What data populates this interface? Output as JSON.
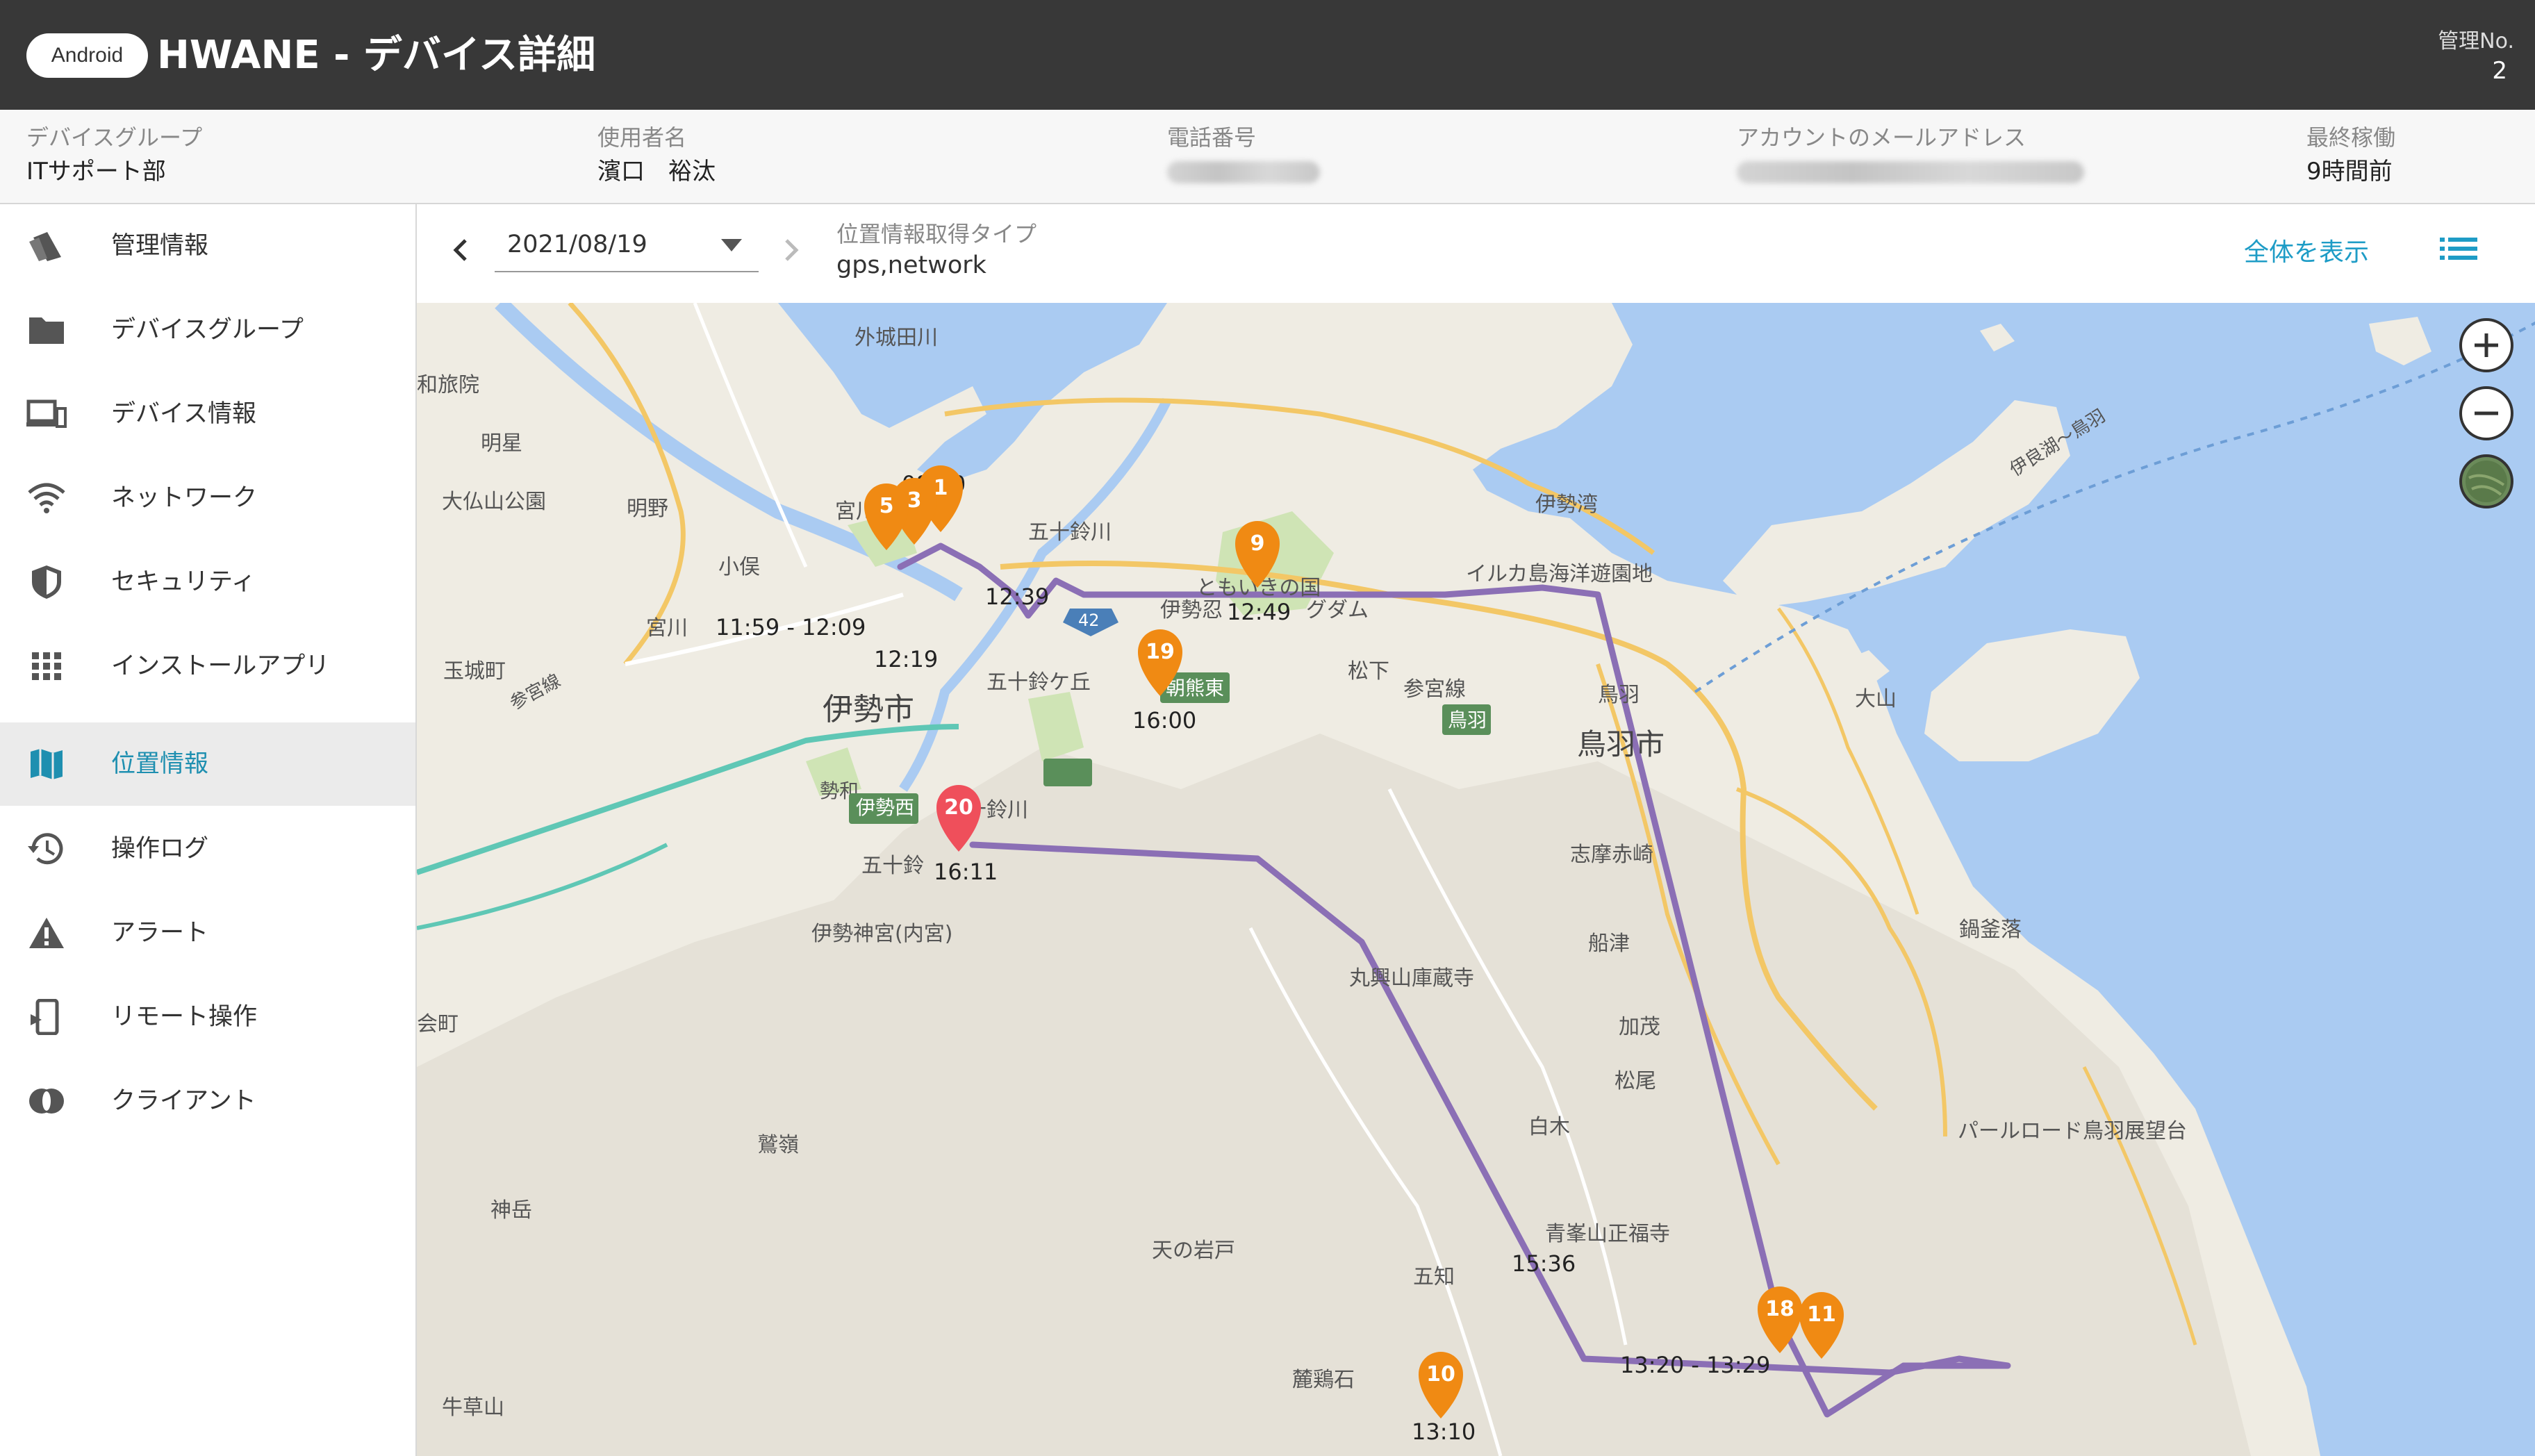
{
  "header": {
    "os_badge": "Android",
    "title": "HWANE - デバイス詳細",
    "mgmt_no_label": "管理No.",
    "mgmt_no_value": "2"
  },
  "info": {
    "device_group_label": "デバイスグループ",
    "device_group_value": "ITサポート部",
    "user_label": "使用者名",
    "user_value": "濱口　裕汰",
    "phone_label": "電話番号",
    "email_label": "アカウントのメールアドレス",
    "last_active_label": "最終稼働",
    "last_active_value": "9時間前"
  },
  "sidebar": {
    "items": [
      {
        "label": "管理情報",
        "icon": "tag-icon"
      },
      {
        "label": "デバイスグループ",
        "icon": "folder-icon"
      },
      {
        "label": "デバイス情報",
        "icon": "devices-icon"
      },
      {
        "label": "ネットワーク",
        "icon": "wifi-icon"
      },
      {
        "label": "セキュリティ",
        "icon": "shield-icon"
      },
      {
        "label": "インストールアプリ",
        "icon": "apps-grid-icon"
      },
      {
        "label": "位置情報",
        "icon": "map-icon",
        "active": true
      },
      {
        "label": "操作ログ",
        "icon": "history-icon"
      },
      {
        "label": "アラート",
        "icon": "warning-icon"
      },
      {
        "label": "リモート操作",
        "icon": "remote-device-icon"
      },
      {
        "label": "クライアント",
        "icon": "client-icon"
      }
    ]
  },
  "toolbar": {
    "date": "2021/08/19",
    "location_type_label": "位置情報取得タイプ",
    "location_type_value": "gps,network",
    "show_all": "全体を表示"
  },
  "map": {
    "route_color": "#8b6fb5",
    "marker_color": "#f08a13",
    "last_marker_color": "#ef4f5b",
    "markers": [
      "1",
      "3",
      "5",
      "9",
      "10",
      "11",
      "18",
      "19",
      "20"
    ],
    "time_labels": [
      "08:50",
      "11:59 - 12:09",
      "12:19",
      "12:39",
      "12:49",
      "16:00",
      "16:11",
      "15:36",
      "13:20 - 13:29",
      "13:10"
    ],
    "place_labels": [
      "外城田川",
      "和旅院",
      "明星",
      "大仏山公園",
      "明野",
      "宮川",
      "小俣",
      "宮川",
      "玉城町",
      "参宮線",
      "伊勢市",
      "五十鈴川",
      "五十鈴ケ丘",
      "朝熊東",
      "伊勢西",
      "五十鈴川",
      "五十鈴",
      "伊勢神宮(内宮)",
      "ともいきの国",
      "伊勢忍",
      "グダム",
      "松下",
      "参宮線",
      "鳥羽",
      "伊勢湾",
      "イルカ島海洋遊園地",
      "鳥羽",
      "鳥羽市",
      "大山",
      "伊良湖〜鳥羽",
      "志摩赤崎",
      "船津",
      "鍋釜落",
      "丸興山庫蔵寺",
      "加茂",
      "松尾",
      "白木",
      "パールロード鳥羽展望台",
      "青峯山正福寺",
      "五知",
      "天の岩戸",
      "鷲嶺",
      "神岳",
      "会町",
      "牛草山",
      "麓鶏石",
      "勢和"
    ]
  }
}
